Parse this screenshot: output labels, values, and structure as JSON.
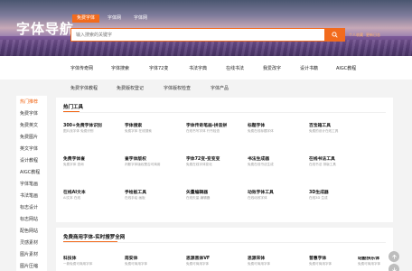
{
  "header": {
    "logo": "字体导航",
    "tabs": [
      "免费字体",
      "字体网",
      "字体网"
    ],
    "search_placeholder": "输入搜索的关键字",
    "links": [
      "个人收藏",
      "更新日志"
    ]
  },
  "nav": {
    "items": [
      "字体传奇网",
      "字体搜索",
      "字体72变",
      "书法字典",
      "在线书法",
      "我爱改字",
      "设计书籍",
      "AIGC教程"
    ]
  },
  "subnav": {
    "items": [
      "免费字体教程",
      "免费版权登记",
      "字体版权检查",
      "字体产品"
    ]
  },
  "sidebar": {
    "items": [
      "热门推荐",
      "免费字体",
      "免费英文",
      "免费图片",
      "英文字体",
      "设计教程",
      "AIGC教程",
      "字体笔画",
      "书法笔画",
      "标志设计",
      "标志网站",
      "配色网站",
      "灵感素材",
      "图片素材",
      "图片压缩"
    ]
  },
  "hot_tools": {
    "title": "热门工具",
    "items": [
      {
        "name": "300+免费字体识别",
        "desc": "图片找字体 免费识别"
      },
      {
        "name": "字体搜索",
        "desc": "免费字体 在线搜索"
      },
      {
        "name": "字体传奇笔画-拼音拼",
        "desc": "在线书写字体 行书检查"
      },
      {
        "name": "标题字体",
        "desc": "免费在线标题字体"
      },
      {
        "name": "百宝箱工具",
        "desc": "免费的设计在线工具"
      },
      {
        "name": "免费字体查",
        "desc": "免费字体 查询"
      },
      {
        "name": "查字体版权",
        "desc": "判断字体版权是否可商用"
      },
      {
        "name": "字体72变-变变变",
        "desc": "免费在线字体变化"
      },
      {
        "name": "书法生成器",
        "desc": "免费在线书法生成"
      },
      {
        "name": "在线书法工具",
        "desc": "在线书法 排版工具"
      },
      {
        "name": "在线AI文本",
        "desc": "AI文本 在线"
      },
      {
        "name": "手绘板工具",
        "desc": "在线手绘 画板"
      },
      {
        "name": "矢量编辑器",
        "desc": "在线矢量 编辑器"
      },
      {
        "name": "动效字体工具",
        "desc": "在线动效字体"
      },
      {
        "name": "3D生成器",
        "desc": "在线3D 生成"
      }
    ]
  },
  "free_fonts": {
    "title": "免费商用字体-实时搜罗全网",
    "items": [
      {
        "name": "科技体",
        "desc": "一款免费可商用字体"
      },
      {
        "name": "南安体",
        "desc": "免费可商用字体"
      },
      {
        "name": "思源黑体VF",
        "desc": "免费可商用字体"
      },
      {
        "name": "思源宋体",
        "desc": "免费可商用字体"
      },
      {
        "name": "普惠字体",
        "desc": "免费可商用字体"
      },
      {
        "name": "站酷快乐体",
        "desc": "免费可商用字体"
      }
    ]
  }
}
